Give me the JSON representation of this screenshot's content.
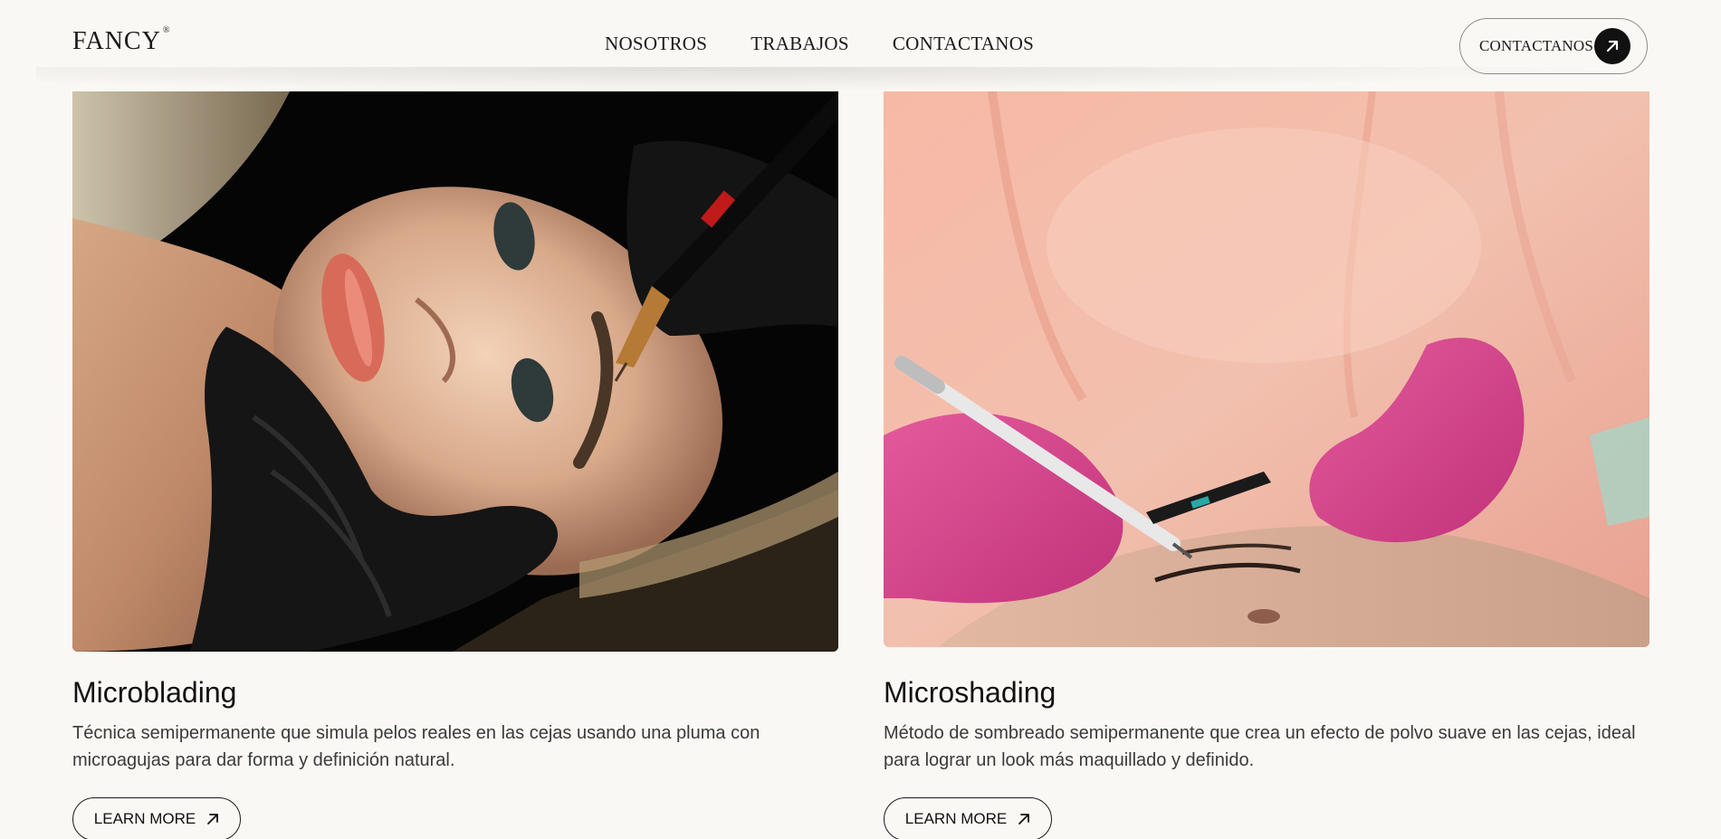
{
  "header": {
    "logo": "FANCY",
    "logo_mark": "®",
    "nav": [
      "NOSOTROS",
      "TRABAJOS",
      "CONTACTANOS"
    ],
    "cta_label": "CONTACTANOS"
  },
  "services": [
    {
      "title": "Microblading",
      "description": "Técnica semipermanente que simula pelos reales en las cejas usando una pluma con microagujas para dar forma y definición natural.",
      "button": "LEARN MORE"
    },
    {
      "title": "Microshading",
      "description": "Método de sombreado semipermanente que crea un efecto de polvo suave en las cejas, ideal para lograr un look más maquillado y definido.",
      "button": "LEARN MORE"
    }
  ],
  "colors": {
    "background": "#faf8f4",
    "text": "#1a1a1a",
    "cta_circle": "#111111"
  }
}
